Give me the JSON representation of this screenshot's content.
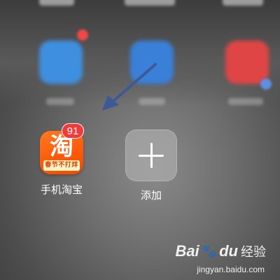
{
  "apps": [
    {
      "label": "手机淘宝",
      "icon_glyph": "淘",
      "icon_banner": "春节不打烊",
      "badge_count": "91",
      "icon_name": "taobao-icon",
      "accent": "#ff5a0a"
    },
    {
      "label": "添加",
      "icon_name": "plus-icon"
    }
  ],
  "watermark": {
    "logo": "Bai",
    "logo2": "du",
    "suffix": "经验",
    "url": "jingyan.baidu.com"
  },
  "annotation": {
    "type": "arrow",
    "color": "#3d5a96"
  },
  "colors": {
    "badge_red": "#f23a3a",
    "label_white": "#ffffff"
  }
}
